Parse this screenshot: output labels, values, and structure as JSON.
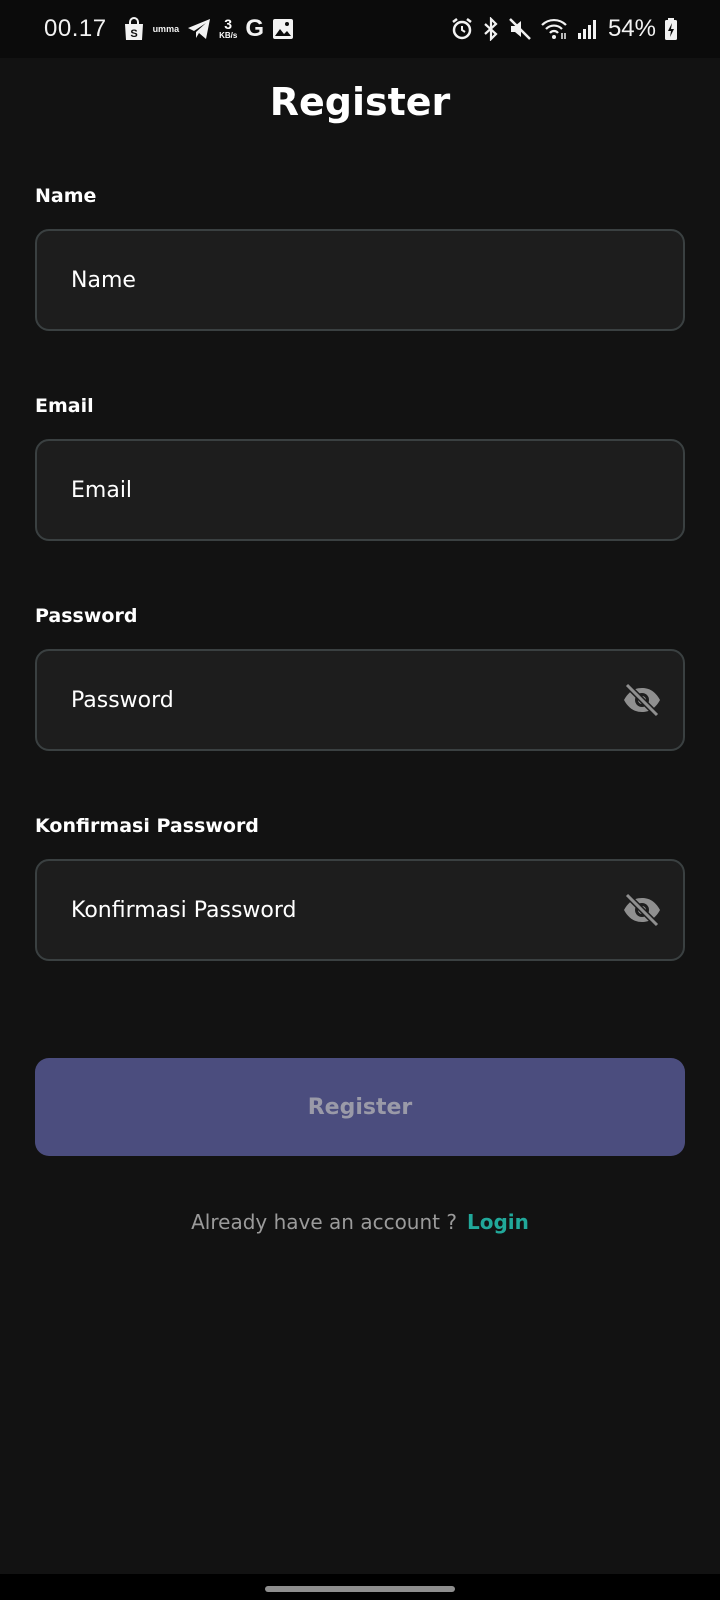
{
  "status_bar": {
    "time": "00.17",
    "net_speed_value": "3",
    "net_speed_unit": "KB/s",
    "carrier_text": "umma",
    "google_letter": "G",
    "battery": "54%",
    "icons": [
      "shopee-bag-icon",
      "telegram-icon",
      "google-icon",
      "image-icon",
      "alarm-icon",
      "bluetooth-icon",
      "mute-icon",
      "wifi-icon",
      "signal-icon",
      "battery-charging-icon"
    ]
  },
  "page": {
    "title": "Register"
  },
  "form": {
    "name": {
      "label": "Name",
      "placeholder": "Name"
    },
    "email": {
      "label": "Email",
      "placeholder": "Email"
    },
    "password": {
      "label": "Password",
      "placeholder": "Password",
      "toggle_icon": "eye-off-icon"
    },
    "confirm_password": {
      "label": "Konfirmasi Password",
      "placeholder": "Konfirmasi Password",
      "toggle_icon": "eye-off-icon"
    },
    "submit_label": "Register"
  },
  "footer": {
    "prompt": "Already have an account ?",
    "link": "Login"
  },
  "colors": {
    "background": "#121212",
    "input_bg": "#1d1d1d",
    "input_border": "#3a4041",
    "button_bg": "#4b4d7e",
    "button_text": "#9a9aa8",
    "link": "#21a89a"
  }
}
